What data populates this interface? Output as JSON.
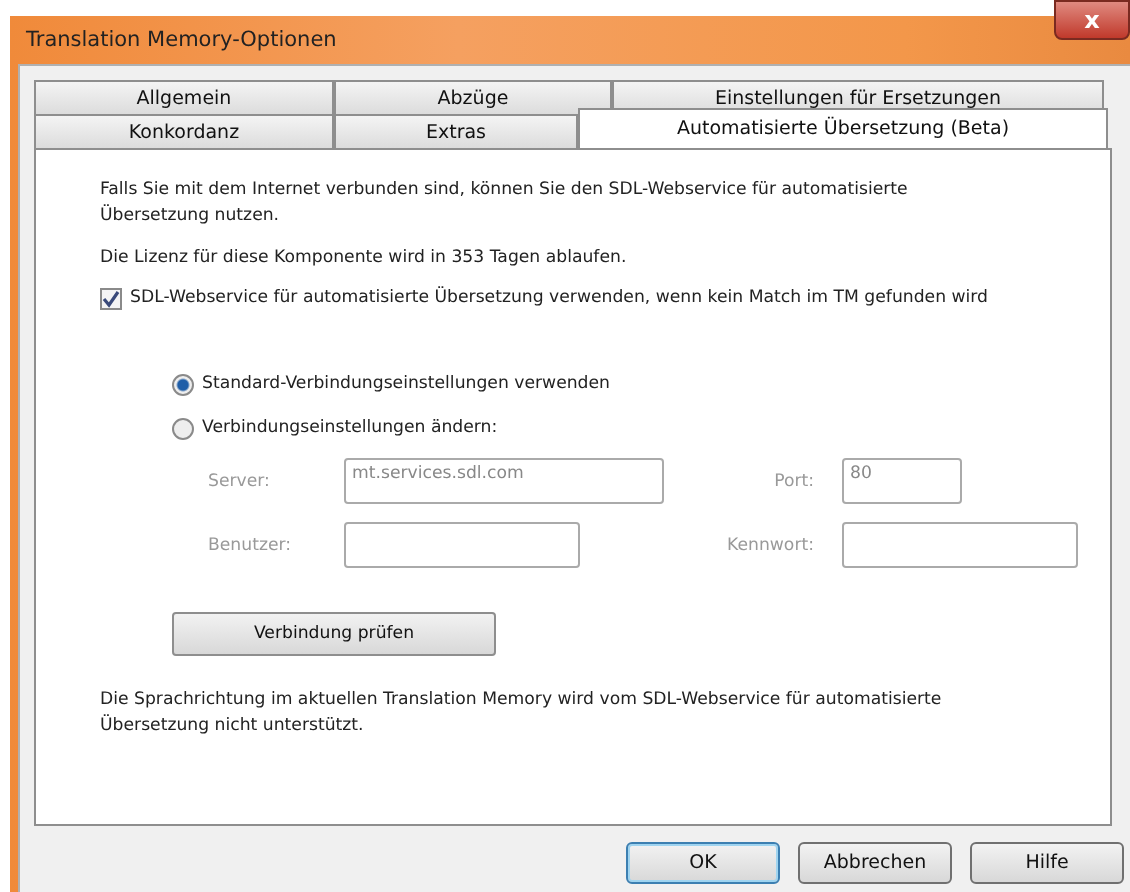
{
  "window": {
    "title": "Translation Memory-Optionen",
    "close": "x"
  },
  "tab_rows": [
    [
      {
        "label": "Allgemein",
        "selected": false
      },
      {
        "label": "Abzüge",
        "selected": false
      },
      {
        "label": "Einstellungen für Ersetzungen",
        "selected": false
      }
    ],
    [
      {
        "label": "Konkordanz",
        "selected": false
      },
      {
        "label": "Extras",
        "selected": false
      },
      {
        "label": "Automatisierte Übersetzung (Beta)",
        "selected": true
      }
    ]
  ],
  "intro": "Falls Sie mit dem Internet verbunden sind, können Sie den SDL-Webservice für automatisierte Übersetzung nutzen.",
  "license": "Die Lizenz für diese Komponente wird in 353 Tagen ablaufen.",
  "use_service": {
    "label": "SDL-Webservice für automatisierte Übersetzung verwenden, wenn kein Match im TM gefunden wird",
    "checked": true
  },
  "radios": [
    {
      "label": "Standard-Verbindungseinstellungen verwenden",
      "selected": true
    },
    {
      "label": "Verbindungseinstellungen ändern:",
      "selected": false
    }
  ],
  "fields": [
    {
      "label": "Server:",
      "value": "mt.services.sdl.com",
      "disabled": true
    },
    {
      "label": "Port:",
      "value": "80",
      "disabled": true
    },
    {
      "label": "Benutzer:",
      "disabled": true
    },
    {
      "label": "Kennwort:",
      "disabled": true
    }
  ],
  "test_button": "Verbindung prüfen",
  "note": "Die Sprachrichtung im aktuellen Translation Memory wird vom SDL-Webservice für automatisierte Übersetzung nicht unterstützt.",
  "buttons": [
    {
      "label": "OK",
      "default": true
    },
    {
      "label": "Abbrechen",
      "default": false
    },
    {
      "label": "Hilfe",
      "default": false
    }
  ]
}
